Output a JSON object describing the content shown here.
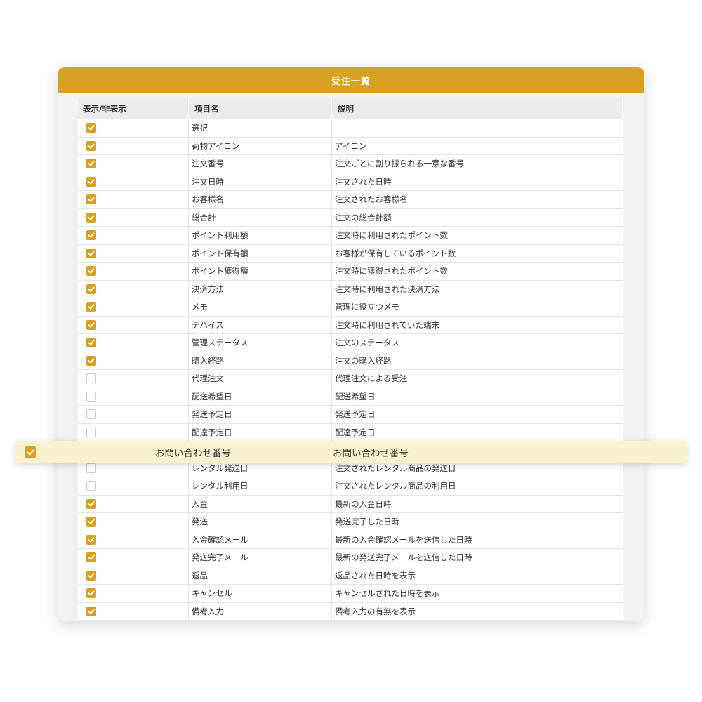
{
  "title": "受注一覧",
  "columns": {
    "visible": "表示/非表示",
    "name": "項目名",
    "description": "説明"
  },
  "accent_color": "#d8a11f",
  "rows": [
    {
      "checked": true,
      "name": "選択",
      "description": ""
    },
    {
      "checked": true,
      "name": "荷物アイコン",
      "description": "アイコン"
    },
    {
      "checked": true,
      "name": "注文番号",
      "description": "注文ごとに割り振られる一意な番号"
    },
    {
      "checked": true,
      "name": "注文日時",
      "description": "注文された日時"
    },
    {
      "checked": true,
      "name": "お客様名",
      "description": "注文されたお客様名"
    },
    {
      "checked": true,
      "name": "総合計",
      "description": "注文の総合計額"
    },
    {
      "checked": true,
      "name": "ポイント利用額",
      "description": "注文時に利用されたポイント数"
    },
    {
      "checked": true,
      "name": "ポイント保有額",
      "description": "お客様が保有しているポイント数"
    },
    {
      "checked": true,
      "name": "ポイント獲得額",
      "description": "注文時に獲得されたポイント数"
    },
    {
      "checked": true,
      "name": "決済方法",
      "description": "注文時に利用された決済方法"
    },
    {
      "checked": true,
      "name": "メモ",
      "description": "管理に役立つメモ"
    },
    {
      "checked": true,
      "name": "デバイス",
      "description": "注文時に利用されていた端末"
    },
    {
      "checked": true,
      "name": "管理ステータス",
      "description": "注文のステータス"
    },
    {
      "checked": true,
      "name": "購入経路",
      "description": "注文の購入経路"
    },
    {
      "checked": false,
      "name": "代理注文",
      "description": "代理注文による受注"
    },
    {
      "checked": false,
      "name": "配送希望日",
      "description": "配送希望日"
    },
    {
      "checked": false,
      "name": "発送予定日",
      "description": "発送予定日"
    },
    {
      "checked": false,
      "name": "配達予定日",
      "description": "配達予定日"
    },
    {
      "checked": true,
      "name": "",
      "description": ""
    },
    {
      "checked": false,
      "name": "レンタル発送日",
      "description": "注文されたレンタル商品の発送日"
    },
    {
      "checked": false,
      "name": "レンタル利用日",
      "description": "注文されたレンタル商品の利用日"
    },
    {
      "checked": true,
      "name": "入金",
      "description": "最新の入金日時"
    },
    {
      "checked": true,
      "name": "発送",
      "description": "発送完了した日時"
    },
    {
      "checked": true,
      "name": "入金確認メール",
      "description": "最新の入金確認メールを送信した日時"
    },
    {
      "checked": true,
      "name": "発送完了メール",
      "description": "最新の発送完了メールを送信した日時"
    },
    {
      "checked": true,
      "name": "返品",
      "description": "返品された日時を表示"
    },
    {
      "checked": true,
      "name": "キャンセル",
      "description": "キャンセルされた日時を表示"
    },
    {
      "checked": true,
      "name": "備考入力",
      "description": "備考入力の有無を表示"
    }
  ],
  "highlight": {
    "checked": true,
    "name": "お問い合わせ番号",
    "description": "お問い合わせ番号"
  }
}
